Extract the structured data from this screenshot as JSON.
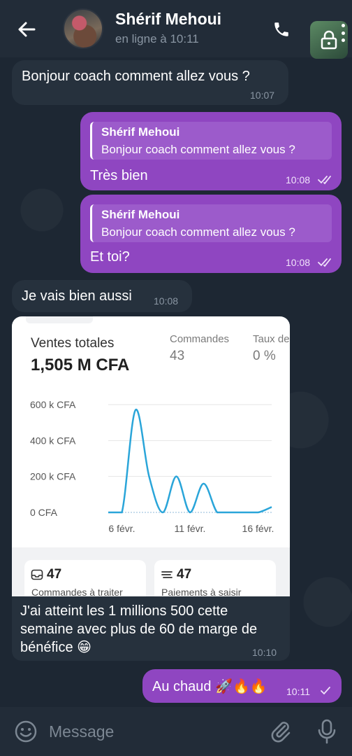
{
  "header": {
    "contact_name": "Shérif Mehoui",
    "status": "en ligne à 10:11"
  },
  "messages": [
    {
      "direction": "in",
      "text": "Bonjour coach comment allez vous ?",
      "time": "10:07"
    },
    {
      "direction": "out",
      "reply_to_name": "Shérif Mehoui",
      "reply_to_text": "Bonjour coach comment allez vous ?",
      "text": "Très bien",
      "time": "10:08",
      "status": "read"
    },
    {
      "direction": "out",
      "reply_to_name": "Shérif Mehoui",
      "reply_to_text": "Bonjour coach comment allez vous ?",
      "text": "Et toi?",
      "time": "10:08",
      "status": "read"
    },
    {
      "direction": "in",
      "text": "Je vais bien aussi",
      "time": "10:08"
    },
    {
      "direction": "in",
      "caption_lines": [
        "J'ai atteint les 1 millions 500 cette",
        "semaine avec plus de 60 de marge de",
        "bénéfice 😁"
      ],
      "time": "10:10"
    },
    {
      "direction": "out",
      "text": "Au chaud 🚀🔥🔥",
      "time": "10:11",
      "status": "sent"
    }
  ],
  "screenshot": {
    "sales_label": "Ventes totales",
    "sales_value": "1,505 M CFA",
    "orders_label": "Commandes",
    "orders_value": "43",
    "rate_label": "Taux de",
    "rate_value": "0 %",
    "card_left": {
      "number": "47",
      "label": "Commandes à traiter"
    },
    "card_right": {
      "number": "47",
      "label": "Paiements à saisir"
    }
  },
  "chart_data": {
    "type": "line",
    "x": [
      "5 févr.",
      "6 févr.",
      "7 févr.",
      "8 févr.",
      "9 févr.",
      "10 févr.",
      "11 févr.",
      "12 févr.",
      "13 févr.",
      "14 févr.",
      "15 févr.",
      "16 févr.",
      "17 févr."
    ],
    "y": [
      0,
      0,
      570,
      200,
      0,
      200,
      0,
      160,
      0,
      0,
      0,
      0,
      30
    ],
    "x_tick_labels": [
      "6 févr.",
      "11 févr.",
      "16 févr."
    ],
    "y_tick_labels": [
      "600 k CFA",
      "400 k CFA",
      "200 k CFA",
      "0 CFA"
    ],
    "y_ticks": [
      600,
      400,
      200,
      0
    ],
    "ylim": [
      0,
      600
    ],
    "units": "k CFA",
    "grid": true,
    "color": "#2aa5d9"
  },
  "input": {
    "placeholder": "Message"
  },
  "colors": {
    "outgoing_bubble": "#8f46c1",
    "incoming_bubble": "#26313d",
    "background": "#1d2733",
    "header": "#222c38"
  },
  "icons": [
    "back-arrow-icon",
    "phone-icon",
    "lock-icon",
    "more-vertical-icon",
    "emoji-icon",
    "paperclip-icon",
    "microphone-icon",
    "double-check-icon",
    "single-check-icon"
  ]
}
